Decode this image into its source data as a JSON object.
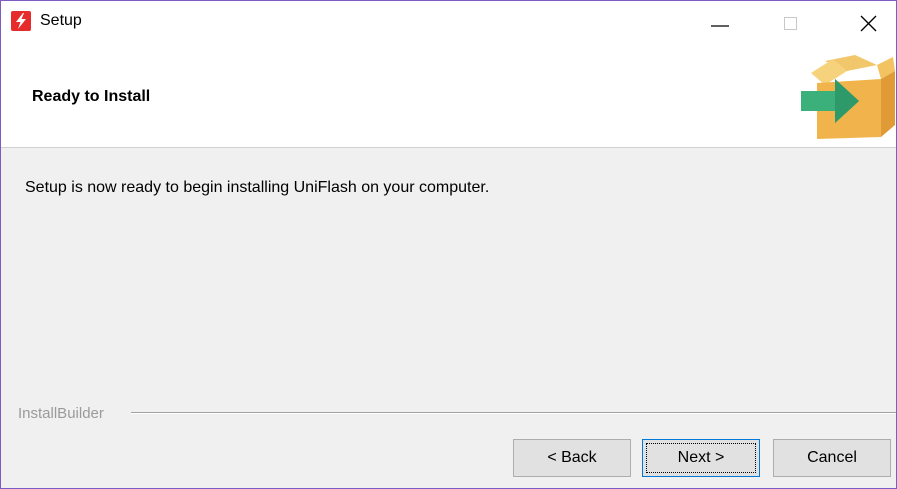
{
  "window": {
    "title": "Setup",
    "accent_color": "#7c5cc4",
    "app_icon": "lightning-bolt-icon",
    "controls": [
      "minimize-icon",
      "maximize-icon",
      "close-icon"
    ]
  },
  "header": {
    "title": "Ready to Install",
    "graphic": "box-arrow-icon"
  },
  "main": {
    "message": "Setup is now ready to begin installing UniFlash on your computer."
  },
  "footer": {
    "brand": "InstallBuilder",
    "buttons": {
      "back": "< Back",
      "next": "Next >",
      "cancel": "Cancel"
    },
    "focused_button": "next"
  }
}
